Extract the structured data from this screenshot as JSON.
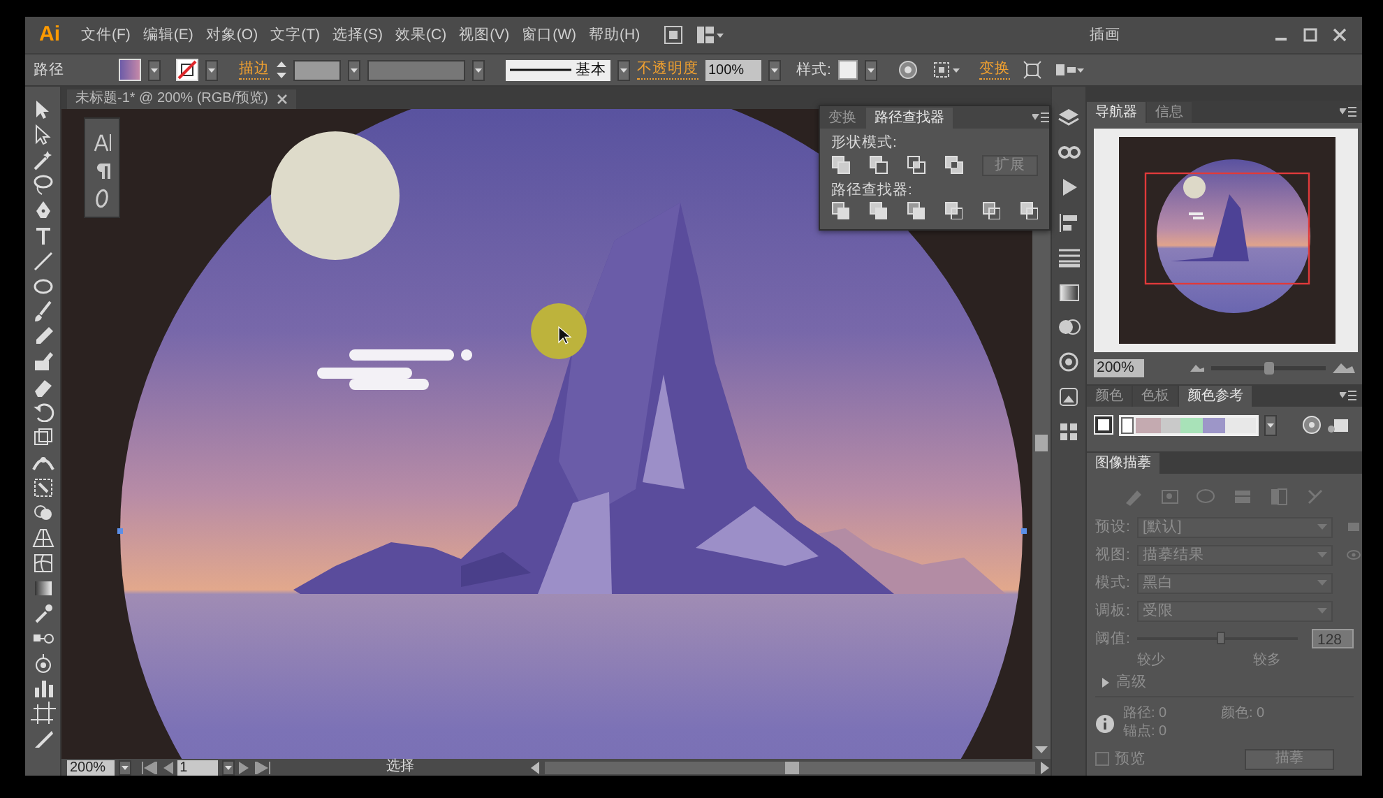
{
  "app": {
    "logo": "Ai",
    "menus": [
      "文件(F)",
      "编辑(E)",
      "对象(O)",
      "文字(T)",
      "选择(S)",
      "效果(C)",
      "视图(V)",
      "窗口(W)",
      "帮助(H)"
    ],
    "workspace": "插画"
  },
  "control_bar": {
    "selection_label": "路径",
    "stroke_label": "描边",
    "brush_label": "基本",
    "opacity_label": "不透明度",
    "opacity": "100%",
    "style_label": "样式:",
    "transform_label": "变换"
  },
  "document_tab": {
    "title": "未标题-1* @ 200% (RGB/预览)"
  },
  "pathfinder_panel": {
    "tabs": [
      {
        "label": "变换",
        "selected": false
      },
      {
        "label": "路径查找器",
        "selected": true
      }
    ],
    "shape_modes_label": "形状模式:",
    "expand_button": {
      "label": "扩展",
      "disabled": true
    },
    "pathfinders_label": "路径查找器:"
  },
  "navigator_panel": {
    "tabs": [
      {
        "label": "导航器",
        "selected": true
      },
      {
        "label": "信息",
        "selected": false
      }
    ],
    "zoom": "200%",
    "zoom_slider": {
      "level": 0.5
    }
  },
  "color_panel": {
    "tabs": [
      {
        "label": "颜色",
        "selected": false
      },
      {
        "label": "色板",
        "selected": false
      },
      {
        "label": "颜色参考",
        "selected": true
      }
    ]
  },
  "image_trace_panel": {
    "title": "图像描摹",
    "disabled": true,
    "fields": [
      {
        "label": "预设:",
        "value": "[默认]"
      },
      {
        "label": "视图:",
        "value": "描摹结果"
      },
      {
        "label": "模式:",
        "value": "黑白"
      },
      {
        "label": "调板:",
        "value": "受限"
      }
    ],
    "threshold": {
      "label": "阈值:",
      "level": 0.52,
      "value": "128",
      "min_label": "较少",
      "max_label": "较多"
    },
    "advanced": {
      "label": "高级",
      "expanded": false
    },
    "stats": [
      {
        "label": "路径:",
        "value": "0"
      },
      {
        "label": "颜色:",
        "value": "0"
      },
      {
        "label": "锚点:",
        "value": "0"
      }
    ],
    "preview": {
      "label": "预览",
      "checked": false
    },
    "trace_button": "描摹"
  },
  "status_bar": {
    "zoom": "200%",
    "page": "1",
    "tool": "选择"
  }
}
